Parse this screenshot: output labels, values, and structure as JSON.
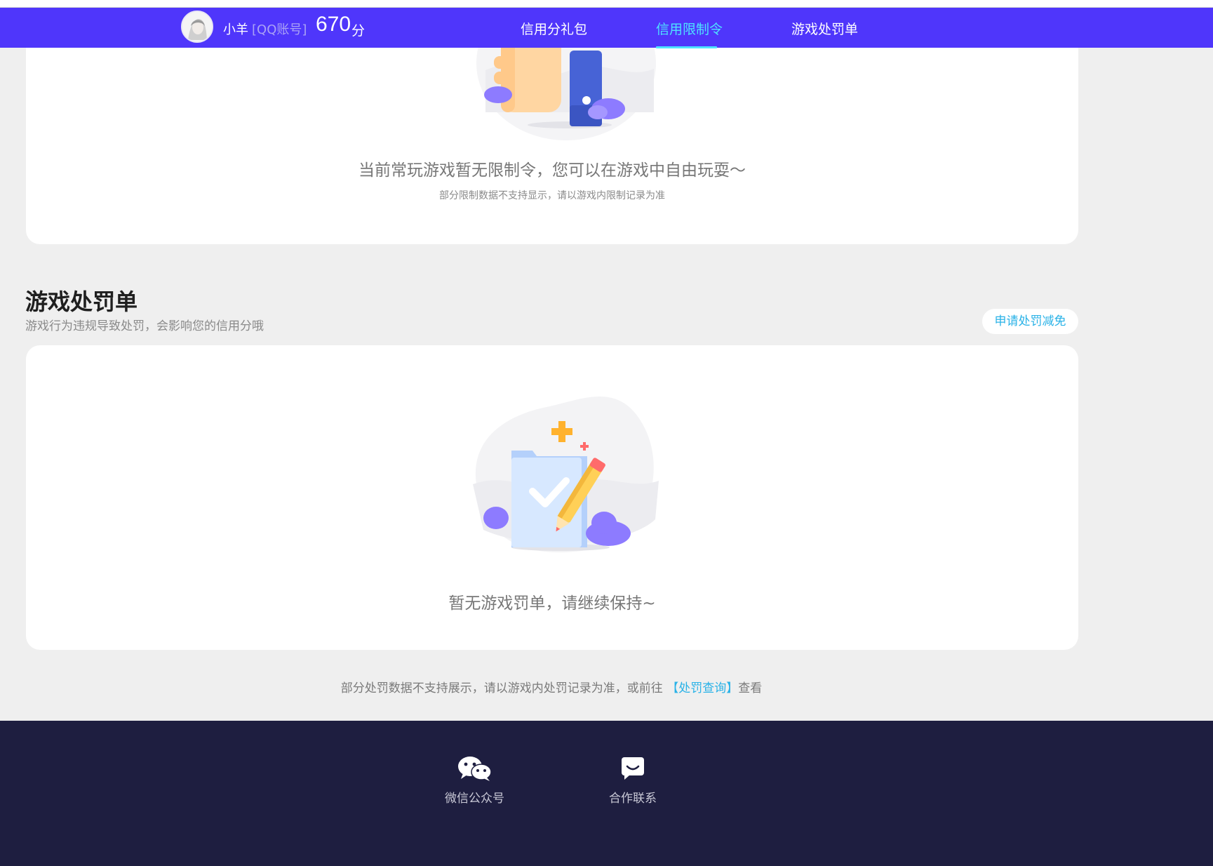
{
  "header": {
    "user_name": "小羊",
    "account_type": "[QQ账号]",
    "score": "670",
    "score_unit": "分",
    "tabs": [
      {
        "label": "信用分礼包",
        "active": false
      },
      {
        "label": "信用限制令",
        "active": true
      },
      {
        "label": "游戏处罚单",
        "active": false
      }
    ],
    "colors": {
      "nav_bg": "#4f36fb",
      "active_tab": "#4ee3ff"
    }
  },
  "restriction_card": {
    "empty_title": "当前常玩游戏暂无限制令，您可以在游戏中自由玩耍～",
    "empty_note": "部分限制数据不支持显示，请以游戏内限制记录为准",
    "illustration_icon": "thumbs-up-phone-illustration"
  },
  "penalty_section": {
    "title": "游戏处罚单",
    "description": "游戏行为违规导致处罚，会影响您的信用分哦",
    "appeal_button": "申请处罚减免",
    "empty_title": "暂无游戏罚单，请继续保持~",
    "illustration_icon": "document-check-pencil-illustration"
  },
  "footnote": {
    "prefix": "部分处罚数据不支持展示，请以游戏内处罚记录为准，或前往",
    "link_text": "【处罚查询】",
    "suffix": "查看"
  },
  "footer": {
    "items": [
      {
        "label": "微信公众号",
        "icon": "wechat-icon"
      },
      {
        "label": "合作联系",
        "icon": "chat-bubble-icon"
      }
    ],
    "colors": {
      "bg": "#1e1e40"
    }
  }
}
